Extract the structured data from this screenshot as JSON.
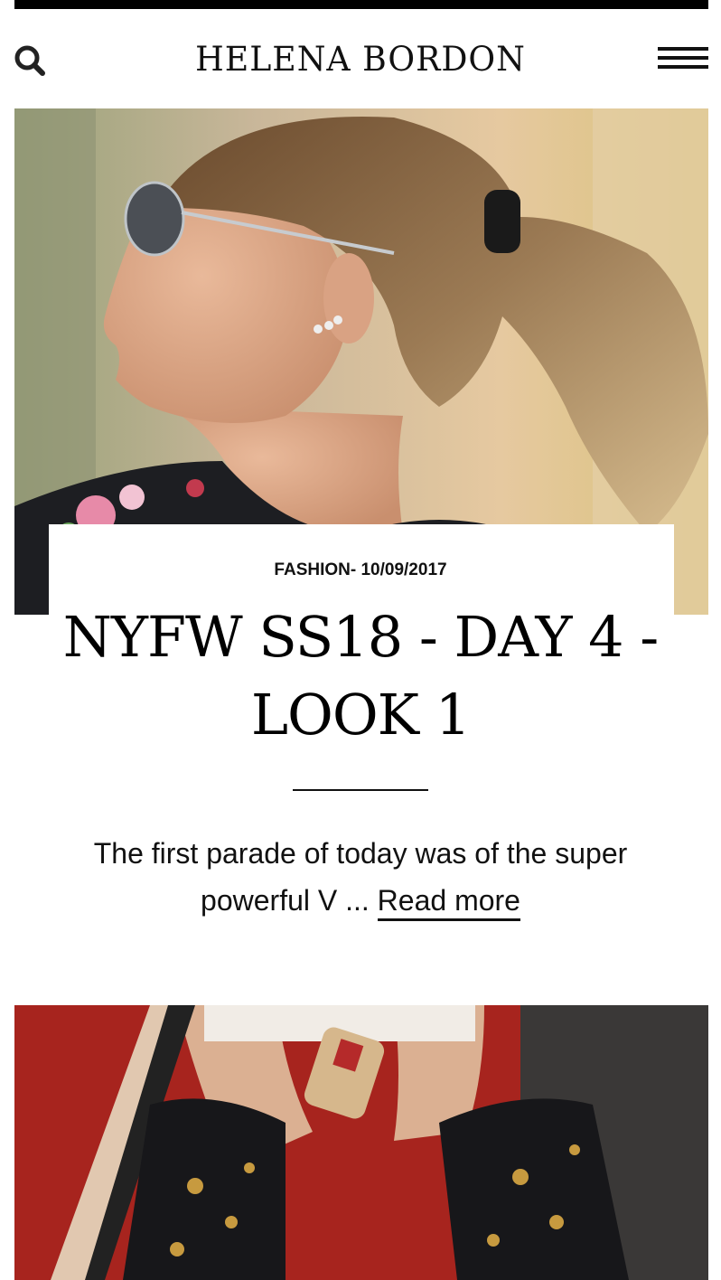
{
  "header": {
    "logo": "HELENA BORDON",
    "search_icon": "search-icon",
    "menu_icon": "hamburger-menu-icon"
  },
  "post": {
    "category_date": "FASHION- 10/09/2017",
    "title": "NYFW SS18 - DAY 4 - LOOK 1",
    "excerpt": "The first parade of today was of the super powerful V ...",
    "read_more": "Read more"
  },
  "colors": {
    "text": "#111111",
    "topbar": "#000000",
    "background": "#ffffff"
  }
}
